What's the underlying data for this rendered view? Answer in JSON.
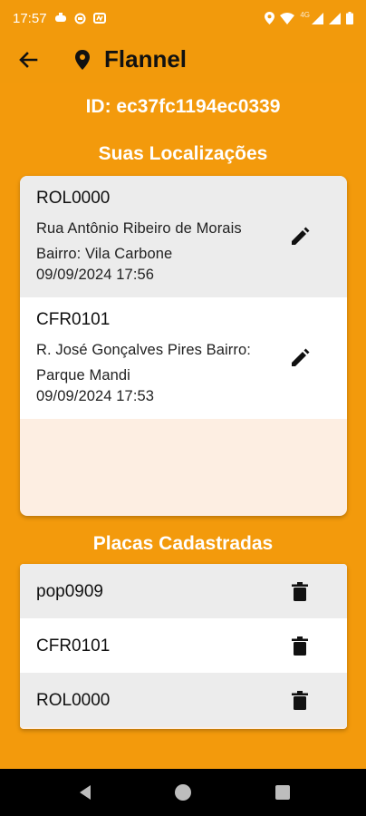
{
  "status_bar": {
    "time": "17:57",
    "network_label": "4G",
    "icons_left": [
      "game-controller-icon",
      "sync-icon",
      "media-icon"
    ],
    "icons_right": [
      "location-icon",
      "wifi-icon",
      "signal-icon",
      "signal-icon",
      "battery-icon"
    ]
  },
  "app_bar": {
    "title": "Flannel",
    "back_icon": "arrow-left-icon",
    "title_icon": "map-pin-icon"
  },
  "user": {
    "id_text": "ID: ec37fc1194ec0339"
  },
  "locations": {
    "title": "Suas Localizações",
    "items": [
      {
        "code": "ROL0000",
        "address": "Rua Antônio Ribeiro de Morais Bairro: Vila Carbone",
        "date": "09/09/2024 17:56",
        "action_icon": "pencil-icon"
      },
      {
        "code": "CFR0101",
        "address": "R. José Gonçalves Pires Bairro: Parque Mandi",
        "date": "09/09/2024 17:53",
        "action_icon": "pencil-icon"
      }
    ]
  },
  "plates": {
    "title": "Placas Cadastradas",
    "items": [
      {
        "label": "pop0909",
        "action_icon": "trash-icon"
      },
      {
        "label": "CFR0101",
        "action_icon": "trash-icon"
      },
      {
        "label": "ROL0000",
        "action_icon": "trash-icon"
      }
    ]
  },
  "colors": {
    "accent": "#f29a0c",
    "card_background": "#fdeee2",
    "row_gray": "#ececec",
    "row_white": "#ffffff",
    "nav_bar": "#000000"
  },
  "nav_bar": {
    "icons": [
      "back-triangle-icon",
      "home-circle-icon",
      "recents-square-icon"
    ]
  }
}
